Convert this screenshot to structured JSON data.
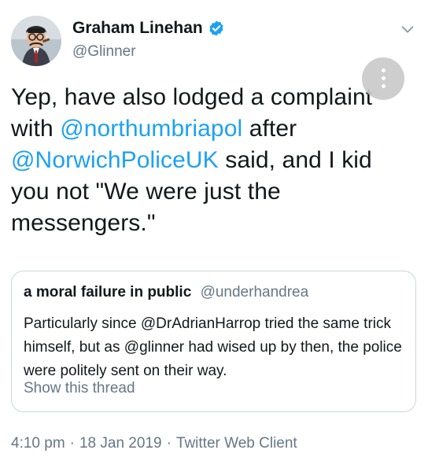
{
  "author": {
    "name": "Graham Linehan",
    "handle": "@Glinner"
  },
  "tweet": {
    "segments": [
      {
        "text": "Yep, have also lodged a complaint with ",
        "type": "text"
      },
      {
        "text": "@northumbriapol",
        "type": "mention"
      },
      {
        "text": " after ",
        "type": "text"
      },
      {
        "text": "@NorwichPoliceUK",
        "type": "mention"
      },
      {
        "text": " said, and I kid you not \"We were just the messengers.\"",
        "type": "text"
      }
    ]
  },
  "quoted": {
    "name": "a moral failure in public",
    "handle": "@underhandrea",
    "text": "Particularly since @DrAdrianHarrop tried the same trick himself, but as @glinner had wised up by then, the police were politely sent on their way.",
    "show_thread": "Show this thread"
  },
  "meta": {
    "time": "4:10 pm",
    "date": "18 Jan 2019",
    "client": "Twitter Web Client",
    "separator": "·"
  },
  "colors": {
    "link": "#1da1f2",
    "secondary": "#657786",
    "border": "#ccd6dd"
  },
  "icons": [
    "verified-badge-icon",
    "chevron-down-icon",
    "more-options-icon"
  ]
}
